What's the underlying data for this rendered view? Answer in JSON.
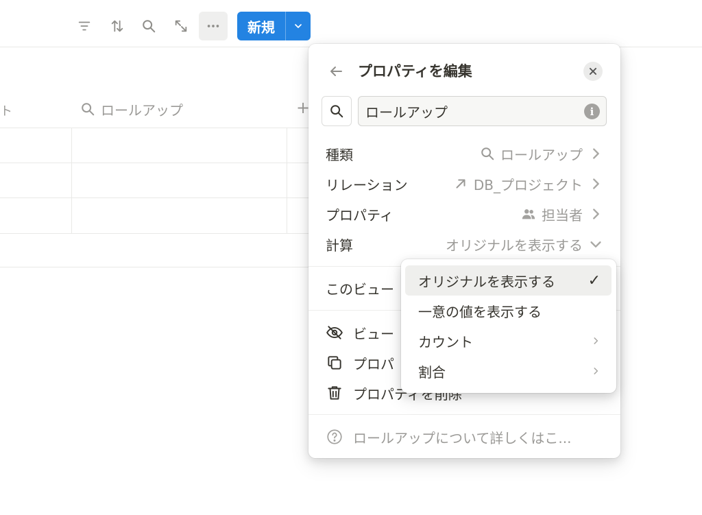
{
  "toolbar": {
    "icons": [
      "filter-icon",
      "sort-icon",
      "search-icon",
      "expand-icon",
      "more-icon"
    ],
    "new_label": "新規"
  },
  "table": {
    "header_cut": "ト",
    "rollup_column": "ロールアップ",
    "add_column": "+"
  },
  "panel": {
    "title": "プロパティを編集",
    "name_value": "ロールアップ",
    "rows": [
      {
        "key": "種類",
        "value": "ロールアップ",
        "icon": "search-icon"
      },
      {
        "key": "リレーション",
        "value": "DB_プロジェクト",
        "icon": "arrow-up-right-icon"
      },
      {
        "key": "プロパティ",
        "value": "担当者",
        "icon": "people-icon"
      },
      {
        "key": "計算",
        "value": "オリジナルを表示する",
        "icon": "chevron-down-icon"
      }
    ],
    "view_row_label": "このビュー",
    "actions": [
      {
        "label": "ビュー",
        "icon": "eye-off-icon"
      },
      {
        "label": "プロパ",
        "icon": "duplicate-icon"
      },
      {
        "label": "プロパティを削除",
        "icon": "trash-icon"
      }
    ],
    "help": "ロールアップについて詳しくはこ..."
  },
  "dropdown": {
    "options": [
      {
        "label": "オリジナルを表示する",
        "selected": true
      },
      {
        "label": "一意の値を表示する",
        "selected": false
      },
      {
        "label": "カウント",
        "submenu": true
      },
      {
        "label": "割合",
        "submenu": true
      }
    ],
    "check": "✓"
  },
  "colors": {
    "accent": "#2383e2",
    "text": "#37352f",
    "muted": "#9b9a97"
  }
}
